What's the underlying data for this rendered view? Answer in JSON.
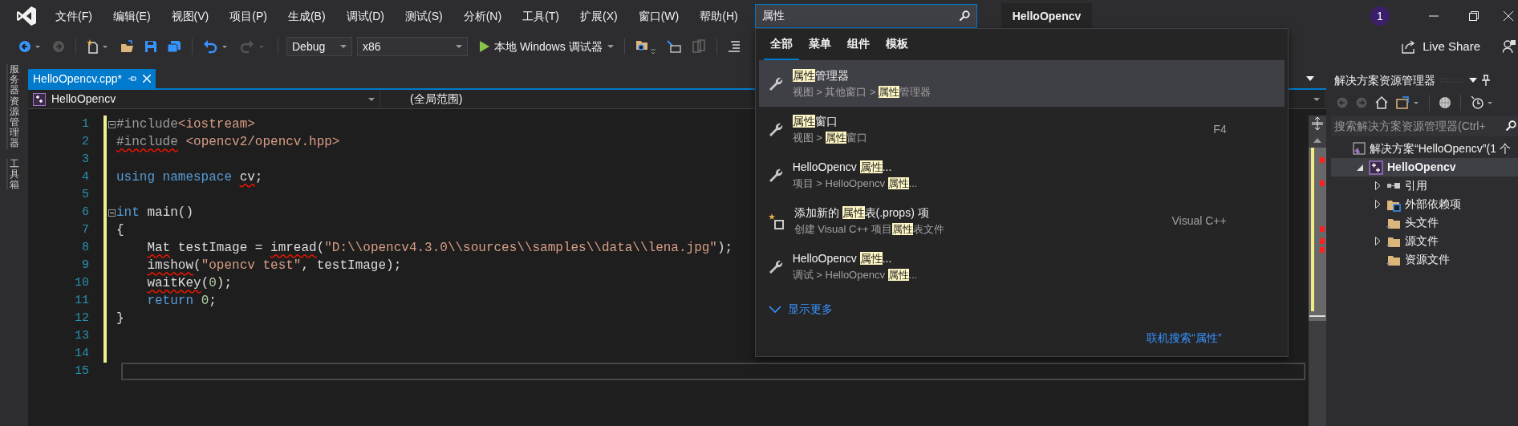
{
  "menu_bar": {
    "items": [
      "文件(F)",
      "编辑(E)",
      "视图(V)",
      "项目(P)",
      "生成(B)",
      "调试(D)",
      "测试(S)",
      "分析(N)",
      "工具(T)",
      "扩展(X)",
      "窗口(W)",
      "帮助(H)"
    ]
  },
  "search": {
    "value": "属性"
  },
  "solution_name": "HelloOpencv",
  "notifications": {
    "count": "1"
  },
  "toolbar": {
    "configuration": "Debug",
    "platform": "x86",
    "debugger": "本地 Windows 调试器",
    "live_share": "Live Share"
  },
  "side_tabs": [
    "服务器资源管理器",
    "工具箱"
  ],
  "editor": {
    "tab": {
      "title": "HelloOpencv.cpp*",
      "selected": true
    },
    "project_selector": "HelloOpencv",
    "scope_selector": "(全局范围)",
    "lines": [
      {
        "number": "1",
        "changed": true,
        "fold": true,
        "current": false,
        "tokens": [
          {
            "text": "#include",
            "kind": "preproc",
            "squiggle": false
          },
          {
            "text": "<iostream>",
            "kind": "string",
            "squiggle": false
          }
        ]
      },
      {
        "number": "2",
        "changed": true,
        "fold": false,
        "current": false,
        "tokens": [
          {
            "text": "#include",
            "kind": "preproc",
            "squiggle": true
          },
          {
            "text": " <opencv2/opencv.hpp>",
            "kind": "string",
            "squiggle": false
          }
        ]
      },
      {
        "number": "3",
        "changed": true,
        "fold": false,
        "current": false
      },
      {
        "number": "4",
        "changed": true,
        "fold": false,
        "current": false,
        "tokens": [
          {
            "text": "using namespace",
            "kind": "keyword",
            "squiggle": false
          },
          {
            "text": " cv",
            "kind": "plain",
            "squiggle": true
          },
          {
            "text": ";",
            "kind": "plain",
            "squiggle": false
          }
        ]
      },
      {
        "number": "5",
        "changed": true,
        "fold": false,
        "current": false
      },
      {
        "number": "6",
        "changed": true,
        "fold": true,
        "current": false,
        "tokens": [
          {
            "text": "int",
            "kind": "keyword",
            "squiggle": false
          },
          {
            "text": " main()",
            "kind": "plain",
            "squiggle": false
          }
        ]
      },
      {
        "number": "7",
        "changed": true,
        "fold": false,
        "current": false,
        "tokens": [
          {
            "text": "{",
            "kind": "plain",
            "squiggle": false
          }
        ]
      },
      {
        "number": "8",
        "changed": true,
        "fold": false,
        "current": false,
        "tokens": [
          {
            "text": "    Mat",
            "kind": "plain",
            "squiggle": true
          },
          {
            "text": " testImage = ",
            "kind": "plain",
            "squiggle": false
          },
          {
            "text": "imread",
            "kind": "plain",
            "squiggle": true
          },
          {
            "text": "(",
            "kind": "plain",
            "squiggle": false
          },
          {
            "text": "\"D:\\\\opencv4.3.0\\\\sources\\\\samples\\\\data\\\\lena.jpg\"",
            "kind": "string",
            "squiggle": false
          },
          {
            "text": ");",
            "kind": "plain",
            "squiggle": false
          }
        ]
      },
      {
        "number": "9",
        "changed": true,
        "fold": false,
        "current": false,
        "tokens": [
          {
            "text": "    imshow",
            "kind": "plain",
            "squiggle": true
          },
          {
            "text": "(",
            "kind": "plain",
            "squiggle": false
          },
          {
            "text": "\"opencv test\"",
            "kind": "string",
            "squiggle": false
          },
          {
            "text": ", testImage);",
            "kind": "plain",
            "squiggle": false
          }
        ]
      },
      {
        "number": "10",
        "changed": true,
        "fold": false,
        "current": false,
        "tokens": [
          {
            "text": "    waitKey",
            "kind": "plain",
            "squiggle": true
          },
          {
            "text": "(",
            "kind": "plain",
            "squiggle": false
          },
          {
            "text": "0",
            "kind": "number",
            "squiggle": false
          },
          {
            "text": ");",
            "kind": "plain",
            "squiggle": false
          }
        ]
      },
      {
        "number": "11",
        "changed": true,
        "fold": false,
        "current": false,
        "tokens": [
          {
            "text": "    return",
            "kind": "keyword",
            "squiggle": false
          },
          {
            "text": " 0",
            "kind": "number",
            "squiggle": false
          },
          {
            "text": ";",
            "kind": "plain",
            "squiggle": false
          }
        ]
      },
      {
        "number": "12",
        "changed": true,
        "fold": false,
        "current": false,
        "tokens": [
          {
            "text": "}",
            "kind": "plain",
            "squiggle": false
          }
        ]
      },
      {
        "number": "13",
        "changed": true,
        "fold": false,
        "current": false
      },
      {
        "number": "14",
        "changed": true,
        "fold": false,
        "current": false
      },
      {
        "number": "15",
        "changed": false,
        "fold": false,
        "current": true
      }
    ]
  },
  "search_popup": {
    "tabs": [
      {
        "label": "全部",
        "selected": true
      },
      {
        "label": "菜单",
        "selected": false
      },
      {
        "label": "组件",
        "selected": false
      },
      {
        "label": "模板",
        "selected": false
      }
    ],
    "results": [
      {
        "kind": "command",
        "selected": true,
        "title": [
          {
            "text": "属性",
            "hl": true
          },
          {
            "text": "管理器",
            "hl": false
          }
        ],
        "path": [
          {
            "text": "视图 > 其他窗口 > ",
            "hl": false
          },
          {
            "text": "属性",
            "hl": true
          },
          {
            "text": "管理器",
            "hl": false
          }
        ]
      },
      {
        "kind": "command",
        "selected": false,
        "shortcut": "F4",
        "title": [
          {
            "text": "属性",
            "hl": true
          },
          {
            "text": "窗口",
            "hl": false
          }
        ],
        "path": [
          {
            "text": "视图 > ",
            "hl": false
          },
          {
            "text": "属性",
            "hl": true
          },
          {
            "text": "窗口",
            "hl": false
          }
        ]
      },
      {
        "kind": "command",
        "selected": false,
        "title": [
          {
            "text": "HelloOpencv ",
            "hl": false
          },
          {
            "text": "属性",
            "hl": true
          },
          {
            "text": "...",
            "hl": false
          }
        ],
        "path": [
          {
            "text": "项目 > HelloOpencv ",
            "hl": false
          },
          {
            "text": "属性",
            "hl": true
          },
          {
            "text": "...",
            "hl": false
          }
        ]
      },
      {
        "kind": "new-item",
        "selected": false,
        "shortcut": "Visual C++",
        "title": [
          {
            "text": "添加新的 ",
            "hl": false
          },
          {
            "text": "属性",
            "hl": true
          },
          {
            "text": "表(.props) 项",
            "hl": false
          }
        ],
        "path": [
          {
            "text": "创建 Visual C++ 项目",
            "hl": false
          },
          {
            "text": "属性",
            "hl": true
          },
          {
            "text": "表文件",
            "hl": false
          }
        ]
      },
      {
        "kind": "command",
        "selected": false,
        "title": [
          {
            "text": "HelloOpencv ",
            "hl": false
          },
          {
            "text": "属性",
            "hl": true
          },
          {
            "text": "...",
            "hl": false
          }
        ],
        "path": [
          {
            "text": "调试 > HelloOpencv ",
            "hl": false
          },
          {
            "text": "属性",
            "hl": true
          },
          {
            "text": "...",
            "hl": false
          }
        ]
      }
    ],
    "show_more": "显示更多",
    "online_search": "联机搜索“属性”"
  },
  "solution_explorer": {
    "title": "解决方案资源管理器",
    "search_placeholder": "搜索解决方案资源管理器(Ctrl+",
    "tree": [
      {
        "label": "解决方案“HelloOpencv”(1 个",
        "kind": "solution",
        "expandable": false,
        "selected": false,
        "children": [
          {
            "label": "HelloOpencv",
            "kind": "project",
            "expandable": true,
            "expanded": true,
            "selected": true,
            "children": [
              {
                "label": "引用",
                "kind": "references",
                "expandable": true,
                "expanded": false,
                "selected": false
              },
              {
                "label": "外部依赖项",
                "kind": "external",
                "expandable": true,
                "expanded": false,
                "selected": false
              },
              {
                "label": "头文件",
                "kind": "filter",
                "expandable": false,
                "selected": false
              },
              {
                "label": "源文件",
                "kind": "filter",
                "expandable": true,
                "expanded": false,
                "selected": false
              },
              {
                "label": "资源文件",
                "kind": "filter",
                "expandable": false,
                "selected": false
              }
            ]
          }
        ]
      }
    ]
  }
}
